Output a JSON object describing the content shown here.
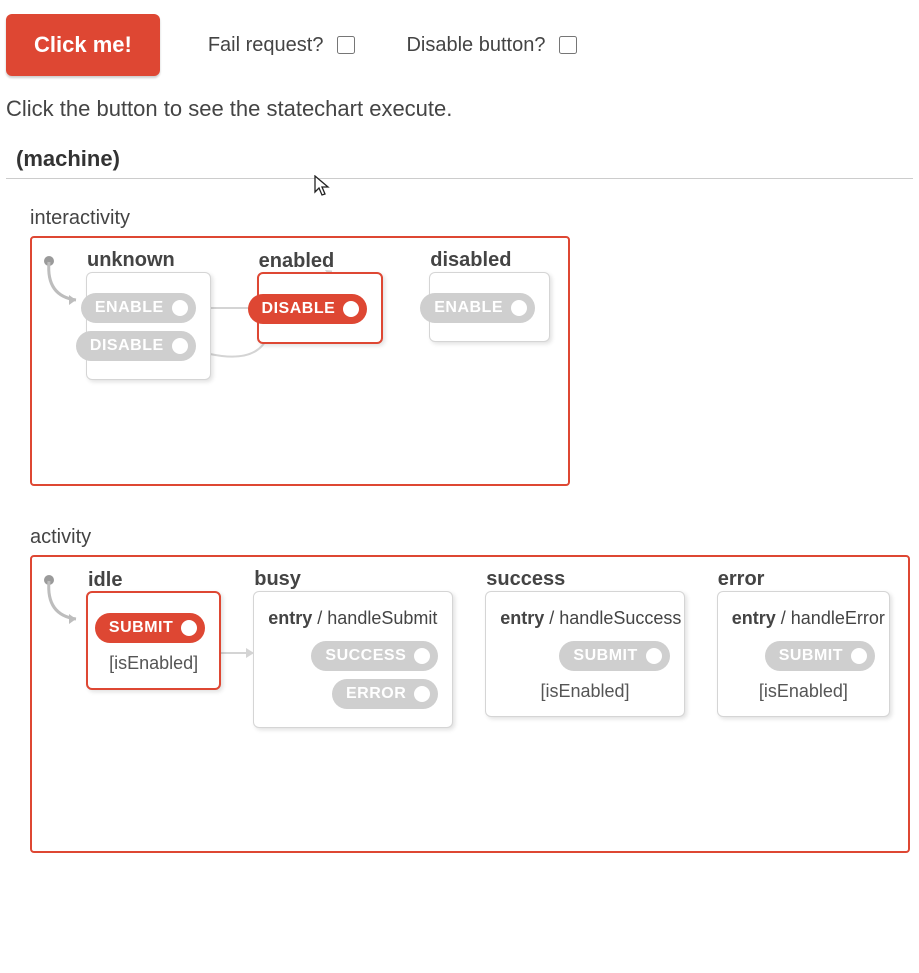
{
  "controls": {
    "click_button": "Click me!",
    "fail_label": "Fail request?",
    "disable_label": "Disable button?"
  },
  "instruction": "Click the button to see the statechart execute.",
  "machine_name": "(machine)",
  "regions": {
    "interactivity": {
      "label": "interactivity",
      "states": {
        "unknown": {
          "title": "unknown",
          "events": [
            "ENABLE",
            "DISABLE"
          ],
          "active": false
        },
        "enabled": {
          "title": "enabled",
          "events": [
            "DISABLE"
          ],
          "active": true
        },
        "disabled": {
          "title": "disabled",
          "events": [
            "ENABLE"
          ],
          "active": false
        }
      }
    },
    "activity": {
      "label": "activity",
      "states": {
        "idle": {
          "title": "idle",
          "events": [
            "SUBMIT"
          ],
          "guard": "[isEnabled]",
          "active": true
        },
        "busy": {
          "title": "busy",
          "entry": "handleSubmit",
          "events": [
            "SUCCESS",
            "ERROR"
          ]
        },
        "success": {
          "title": "success",
          "entry": "handleSuccess",
          "events": [
            "SUBMIT"
          ],
          "guard": "[isEnabled]"
        },
        "error": {
          "title": "error",
          "entry": "handleError",
          "events": [
            "SUBMIT"
          ],
          "guard": "[isEnabled]"
        }
      }
    }
  },
  "entry_word": "entry"
}
